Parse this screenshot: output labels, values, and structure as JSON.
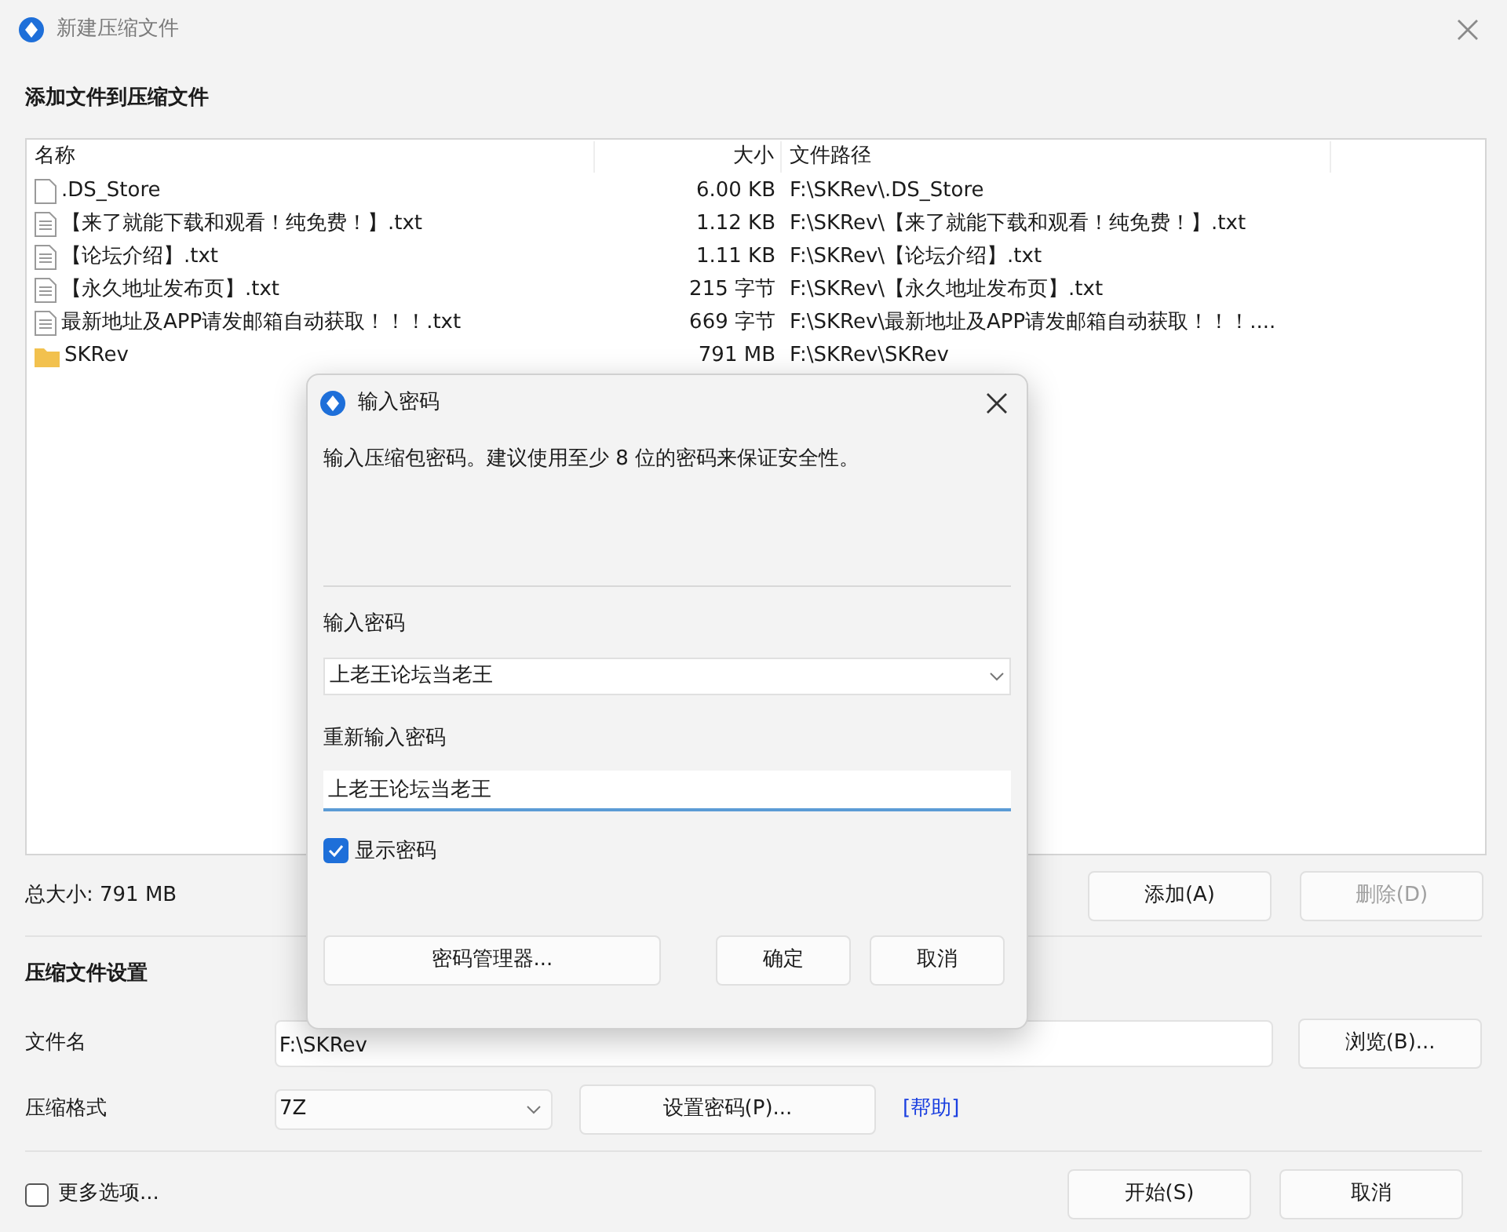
{
  "window": {
    "title": "新建压缩文件"
  },
  "files_section": {
    "title": "添加文件到压缩文件"
  },
  "table": {
    "columns": [
      "名称",
      "大小",
      "文件路径"
    ],
    "rows": [
      {
        "kind": "file",
        "name": ".DS_Store",
        "size": "6.00 KB",
        "path": "F:\\SKRev\\.DS_Store"
      },
      {
        "kind": "text",
        "name": "【来了就能下载和观看！纯免费！】.txt",
        "size": "1.12 KB",
        "path": "F:\\SKRev\\【来了就能下载和观看！纯免费！】.txt"
      },
      {
        "kind": "text",
        "name": "【论坛介绍】.txt",
        "size": "1.11 KB",
        "path": "F:\\SKRev\\【论坛介绍】.txt"
      },
      {
        "kind": "text",
        "name": "【永久地址发布页】.txt",
        "size": "215 字节",
        "path": "F:\\SKRev\\【永久地址发布页】.txt"
      },
      {
        "kind": "text",
        "name": "最新地址及APP请发邮箱自动获取！！！.txt",
        "size": "669 字节",
        "path": "F:\\SKRev\\最新地址及APP请发邮箱自动获取！！！...."
      },
      {
        "kind": "folder",
        "name": "SKRev",
        "size": "791 MB",
        "path": "F:\\SKRev\\SKRev"
      }
    ]
  },
  "total": "总大小: 791 MB",
  "list_buttons": [
    {
      "label": "添加(A)",
      "disabled": false
    },
    {
      "label": "删除(D)",
      "disabled": true
    }
  ],
  "settings": {
    "title": "压缩文件设置",
    "filename_label": "文件名",
    "filename": "F:\\SKRev",
    "browse": "浏览(B)...",
    "format_label": "压缩格式",
    "format": "7Z",
    "set_password": "设置密码(P)...",
    "help": "[帮助]"
  },
  "more_options": {
    "label": "更多选项...",
    "checked": false
  },
  "footer_buttons": [
    "开始(S)",
    "取消"
  ],
  "dialog": {
    "title": "输入密码",
    "description": "输入压缩包密码。建议使用至少 8 位的密码来保证安全性。",
    "password_label": "输入密码",
    "password": "上老王论坛当老王",
    "confirm_label": "重新输入密码",
    "confirm": "上老王论坛当老王",
    "show_password": {
      "label": "显示密码",
      "checked": true
    },
    "manager": "密码管理器...",
    "ok": "确定",
    "cancel": "取消"
  }
}
